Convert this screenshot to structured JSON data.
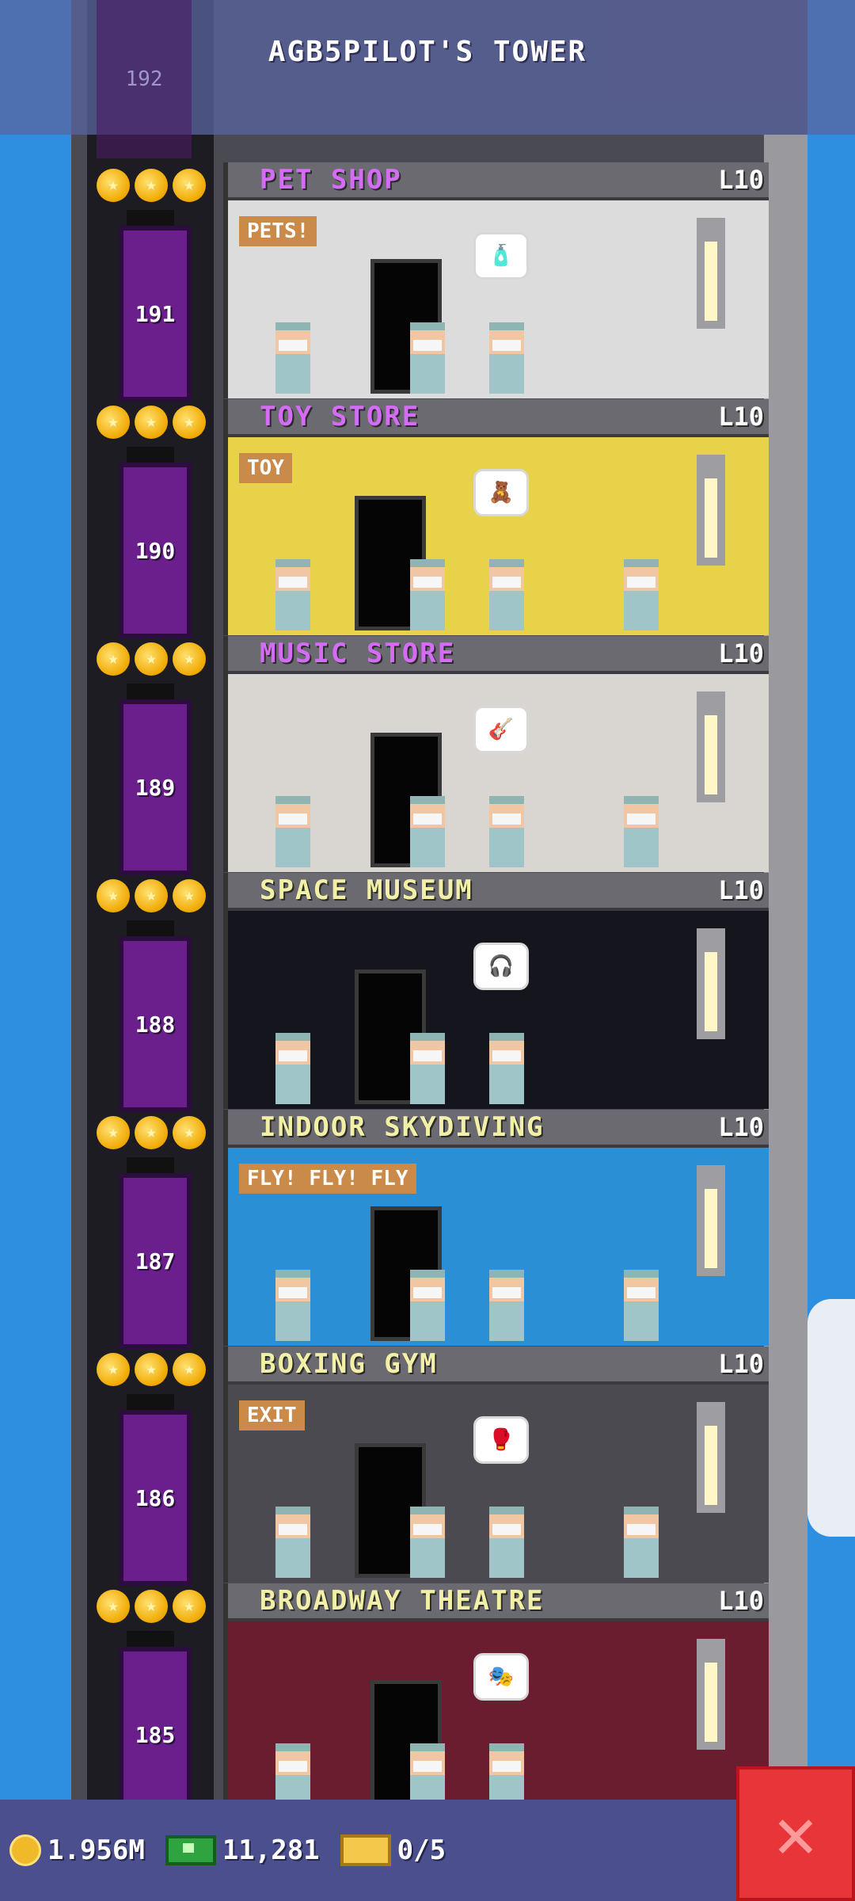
{
  "tower": {
    "title": "AGB5PILOT'S TOWER",
    "roof_floor_number": "192"
  },
  "floors": [
    {
      "number": "191",
      "name": "PET SHOP",
      "level": "L10",
      "name_color": "#d46cf5",
      "bg": "#dcdcdc",
      "sign": "PETS!",
      "bubble": "🧴"
    },
    {
      "number": "190",
      "name": "TOY STORE",
      "level": "L10",
      "name_color": "#d46cf5",
      "bg": "#e8d24a",
      "sign": "TOY",
      "bubble": "🧸"
    },
    {
      "number": "189",
      "name": "MUSIC STORE",
      "level": "L10",
      "name_color": "#d46cf5",
      "bg": "#d9d6d2",
      "sign": "",
      "bubble": "🎸"
    },
    {
      "number": "188",
      "name": "SPACE MUSEUM",
      "level": "L10",
      "name_color": "#f1f0a6",
      "bg": "#15151d",
      "sign": "",
      "bubble": "🎧"
    },
    {
      "number": "187",
      "name": "INDOOR SKYDIVING",
      "level": "L10",
      "name_color": "#f1f0a6",
      "bg": "#2b8fd6",
      "sign": "FLY! FLY! FLY",
      "bubble": ""
    },
    {
      "number": "186",
      "name": "BOXING GYM",
      "level": "L10",
      "name_color": "#f1f0a6",
      "bg": "#4a4a50",
      "sign": "EXIT",
      "bubble": "🥊"
    },
    {
      "number": "185",
      "name": "BROADWAY THEATRE",
      "level": "L10",
      "name_color": "#f1f0a6",
      "bg": "#6a1d2e",
      "sign": "",
      "bubble": "🎭"
    }
  ],
  "stats": {
    "coins": "1.956M",
    "bux": "11,281",
    "tickets": "0/5"
  },
  "colors": {
    "sky": "#2e8fe0",
    "elevator": "#6a1f8c",
    "close_button": "#e7353a"
  }
}
